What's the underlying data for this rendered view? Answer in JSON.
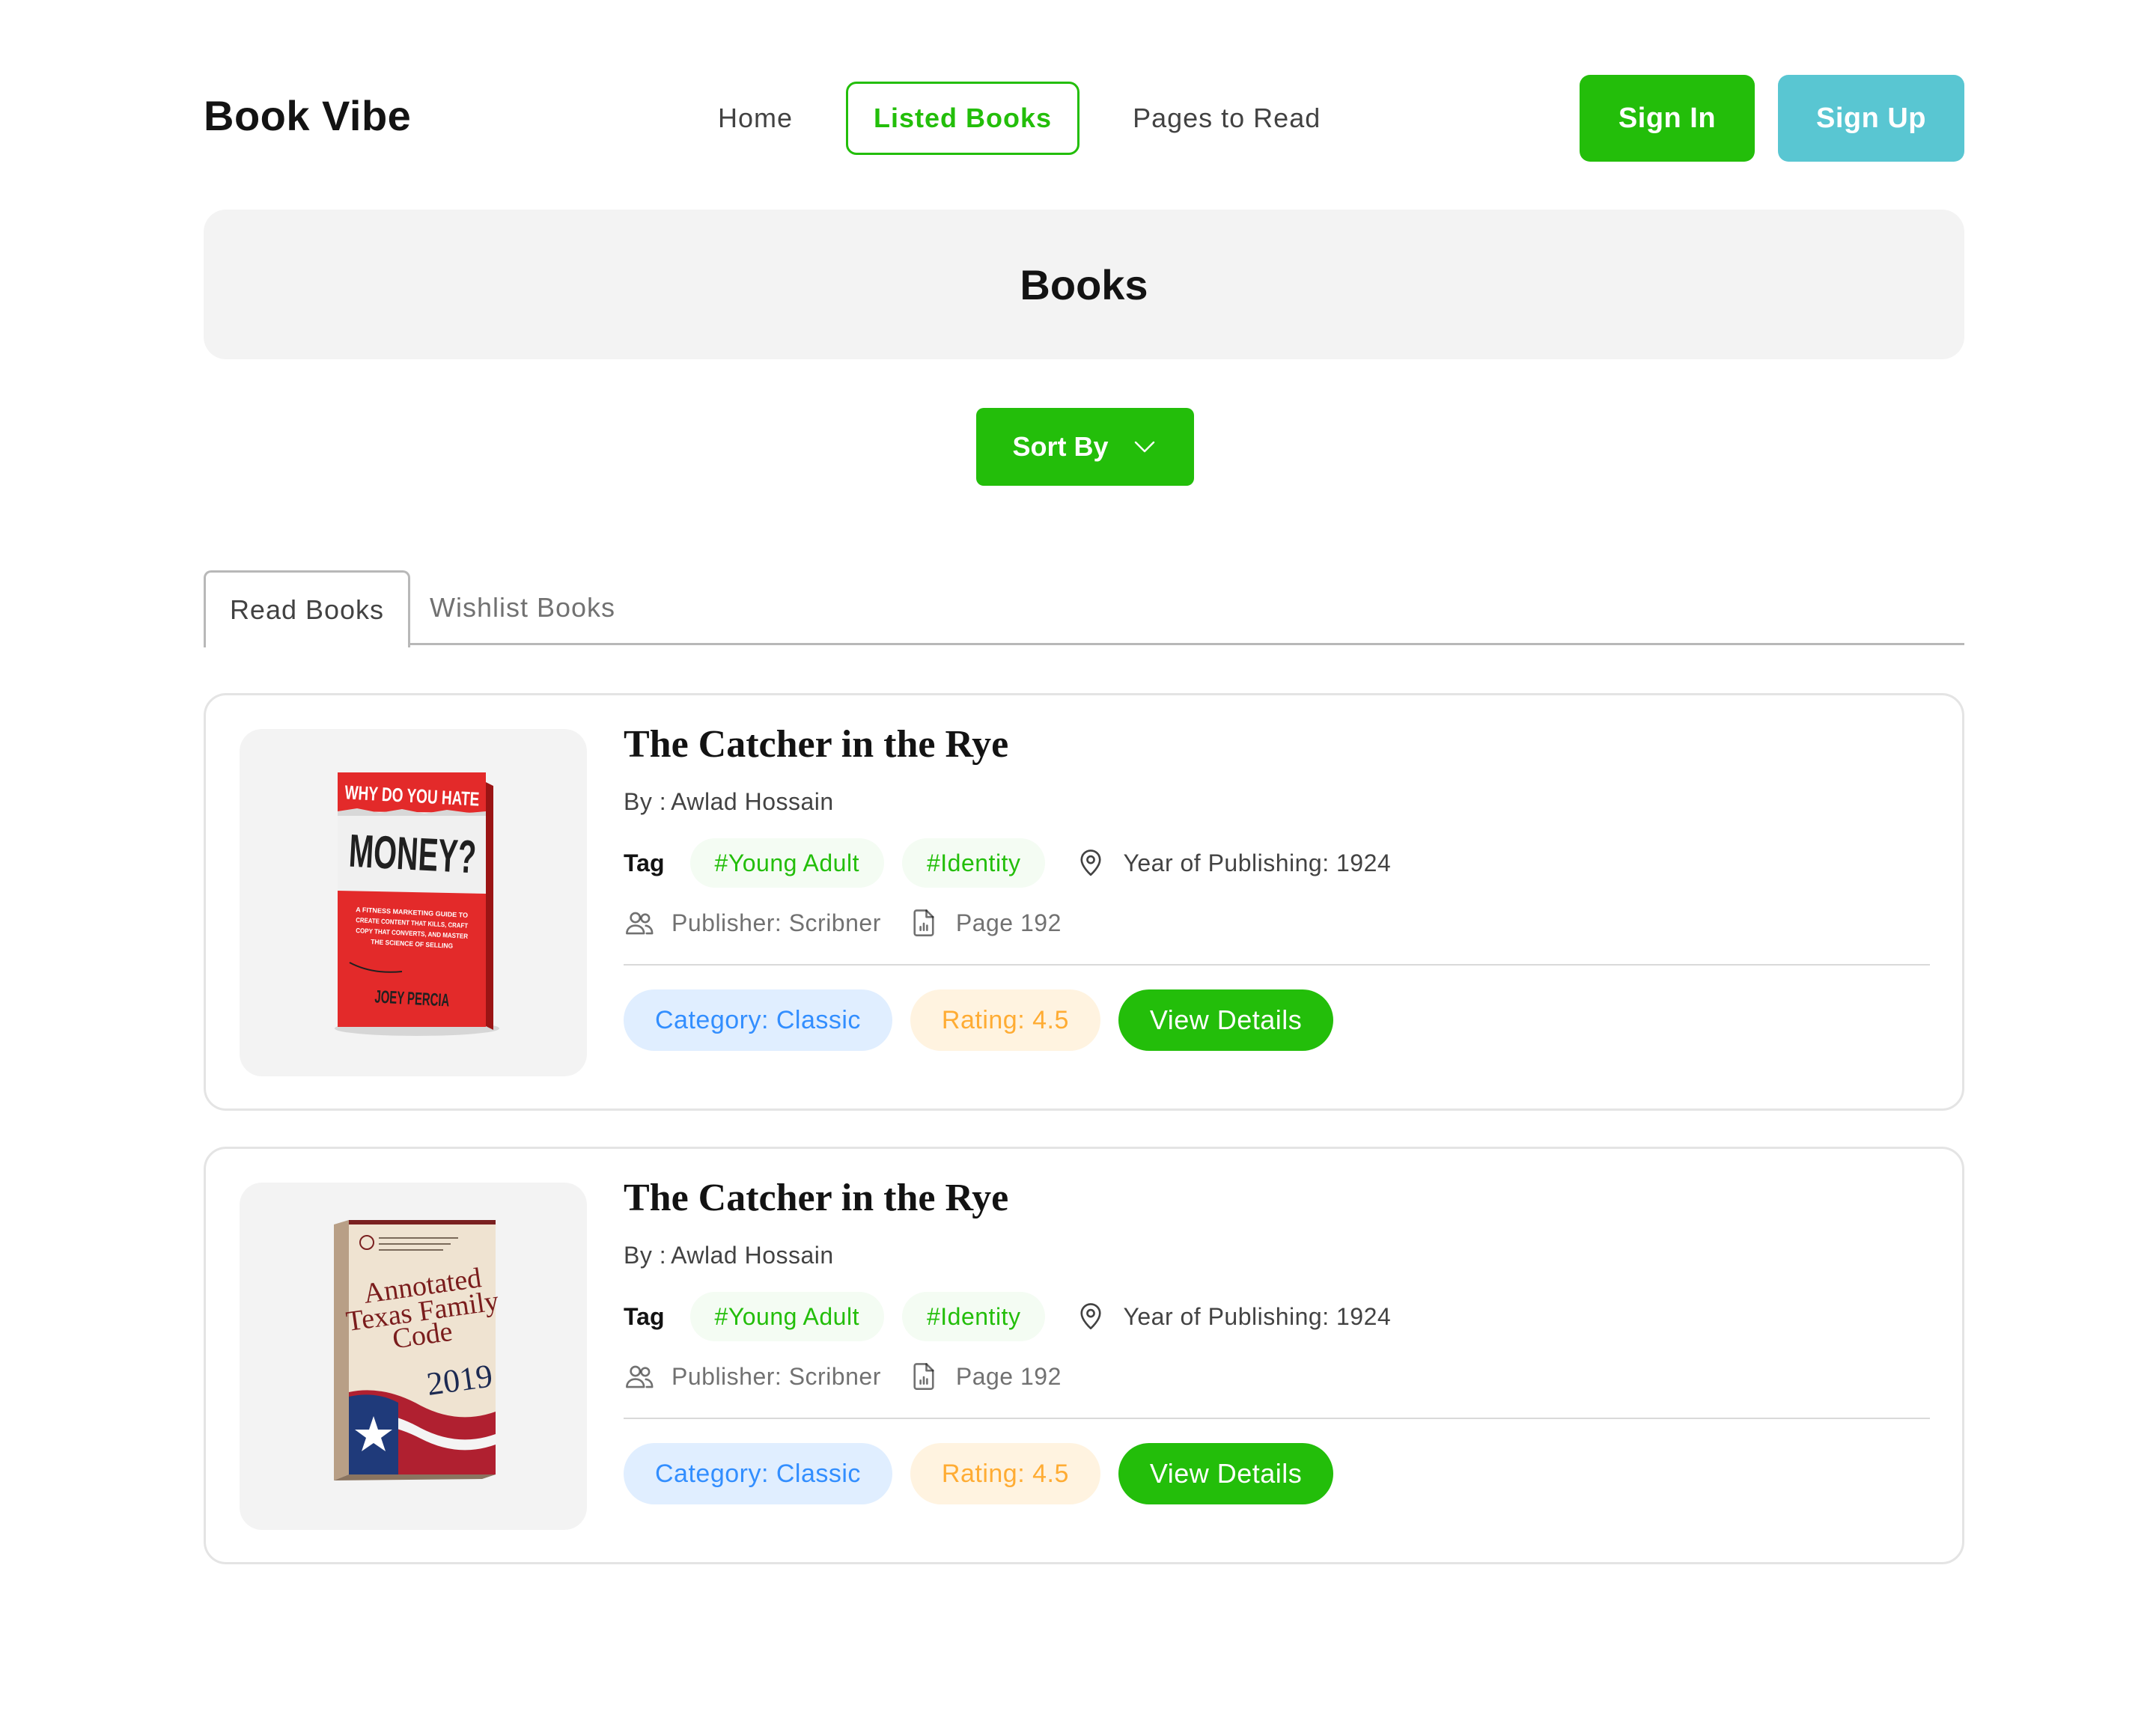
{
  "navbar": {
    "logo": "Book Vibe",
    "links": [
      {
        "label": "Home"
      },
      {
        "label": "Listed Books"
      },
      {
        "label": "Pages to Read"
      }
    ],
    "sign_in": "Sign In",
    "sign_up": "Sign Up"
  },
  "banner": {
    "title": "Books"
  },
  "sort": {
    "label": "Sort By",
    "icon": "chevron-down-icon"
  },
  "tabs": [
    {
      "label": "Read Books",
      "active": true
    },
    {
      "label": "Wishlist Books",
      "active": false
    }
  ],
  "books": [
    {
      "title": "The Catcher in the Rye",
      "author_prefix": "By :",
      "author": "Awlad Hossain",
      "tag_label": "Tag",
      "tags": [
        "#Young Adult",
        "#Identity"
      ],
      "year": "Year of Publishing: 1924",
      "publisher": "Publisher: Scribner",
      "pages": "Page 192",
      "category": "Category: Classic",
      "rating": "Rating: 4.5",
      "view_label": "View Details",
      "cover": {
        "line1": "WHY DO YOU HATE",
        "line2": "MONEY?",
        "subtitle": "A FITNESS MARKETING GUIDE TO CREATE CONTENT THAT KILLS, CRAFT COPY THAT CONVERTS, AND MASTER THE SCIENCE OF SELLING",
        "author": "JOEY PERCIA"
      }
    },
    {
      "title": "The Catcher in the Rye",
      "author_prefix": "By :",
      "author": "Awlad Hossain",
      "tag_label": "Tag",
      "tags": [
        "#Young Adult",
        "#Identity"
      ],
      "year": "Year of Publishing: 1924",
      "publisher": "Publisher: Scribner",
      "pages": "Page 192",
      "category": "Category: Classic",
      "rating": "Rating: 4.5",
      "view_label": "View Details",
      "cover": {
        "line1": "Annotated",
        "line2": "Texas Family",
        "line3": "Code",
        "year": "2019"
      }
    }
  ],
  "colors": {
    "primary_green": "#23BE0A",
    "sign_up_teal": "#59C6D2",
    "category_blue": "#328EFF",
    "rating_orange": "#FFAC33"
  }
}
